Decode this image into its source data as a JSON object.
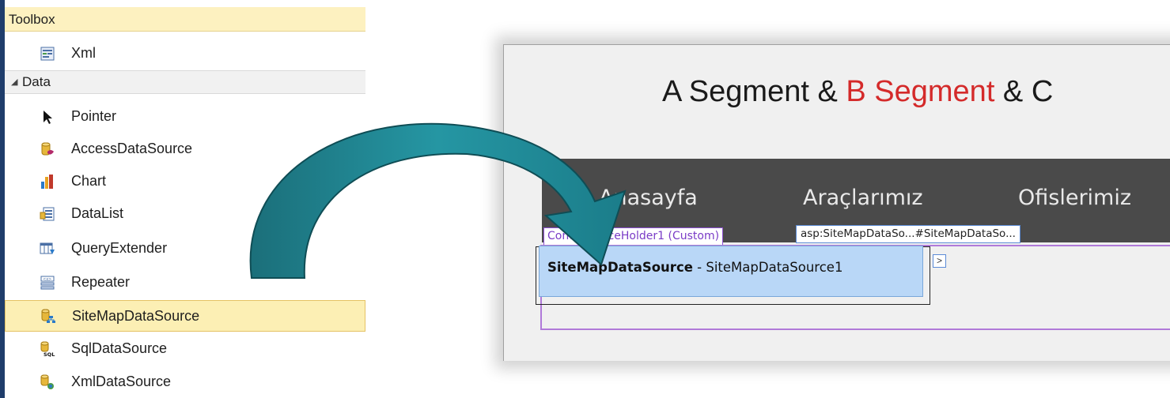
{
  "toolbox": {
    "title": "Toolbox",
    "items_before": [
      {
        "label": "Xml",
        "icon": "xml-control-icon"
      }
    ],
    "category": {
      "label": "Data",
      "expanded": true
    },
    "data_items": [
      {
        "label": "Pointer",
        "icon": "pointer-icon"
      },
      {
        "label": "AccessDataSource",
        "icon": "access-data-source-icon"
      },
      {
        "label": "Chart",
        "icon": "chart-icon"
      },
      {
        "label": "DataList",
        "icon": "datalist-icon"
      },
      {
        "label": "QueryExtender",
        "icon": "query-extender-icon"
      },
      {
        "label": "Repeater",
        "icon": "repeater-icon"
      },
      {
        "label": "SiteMapDataSource",
        "icon": "sitemap-data-source-icon",
        "selected": true
      },
      {
        "label": "SqlDataSource",
        "icon": "sql-data-source-icon"
      },
      {
        "label": "XmlDataSource",
        "icon": "xml-data-source-icon"
      }
    ],
    "colors": {
      "selected_bg": "#fcefb4",
      "title_bg": "#fdf1c0"
    }
  },
  "arrow": {
    "color": "#1f8a96"
  },
  "designer": {
    "header": {
      "part1": "A Segment & ",
      "part2": "B Segment",
      "part3": " & C"
    },
    "nav": [
      "Anasayfa",
      "Araçlarımız",
      "Ofislerimiz"
    ],
    "content_placeholder_tag": "ContentPlaceHolder1 (Custom)",
    "asp_tag": "asp:SiteMapDataSo...#SiteMapDataSo...",
    "control": {
      "type_label": "SiteMapDataSource",
      "separator": " - ",
      "id": "SiteMapDataSource1"
    },
    "smart_tag_glyph": ">"
  }
}
